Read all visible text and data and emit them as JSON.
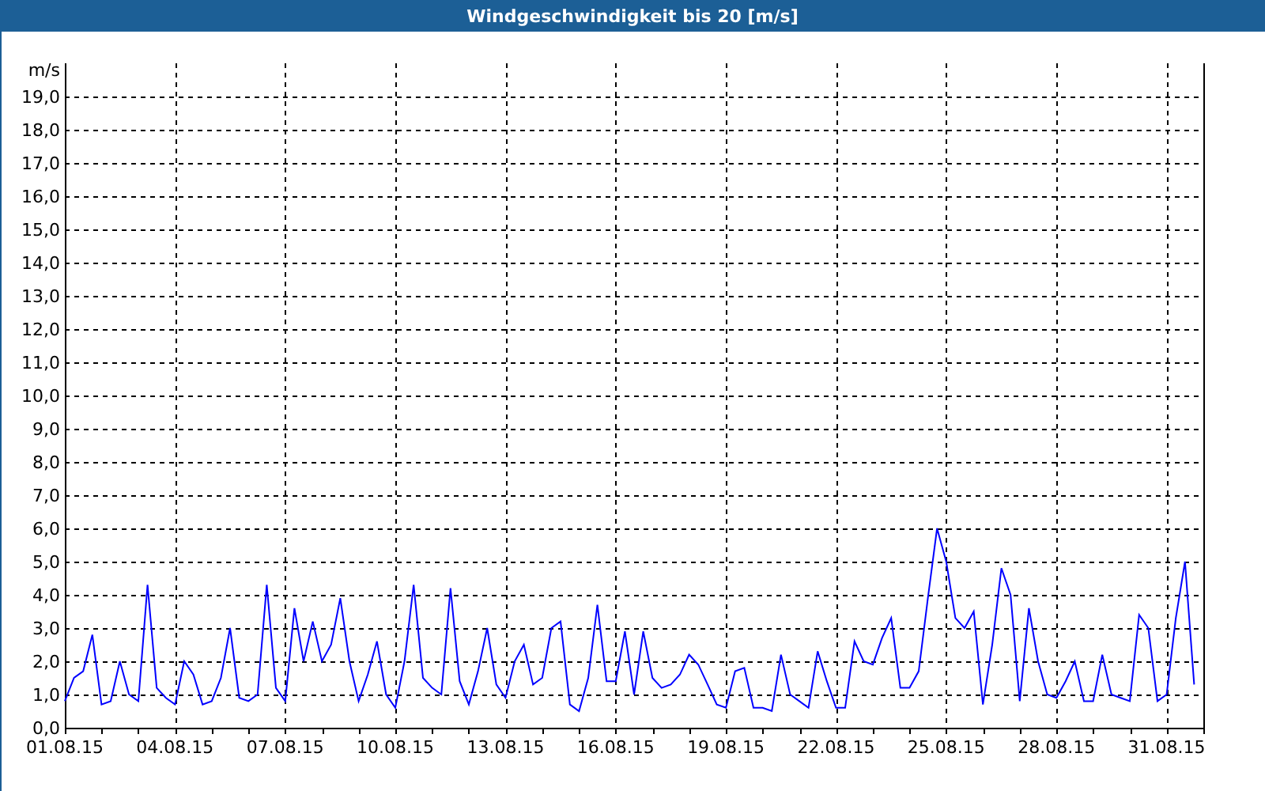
{
  "window": {
    "title": "Windgeschwindigkeit bis 20 [m/s]"
  },
  "chart": {
    "chart_data": {
      "type": "line",
      "grid": true,
      "ylabel": "m/s",
      "ylim": [
        0,
        20
      ],
      "yticks": [
        {
          "value": 0,
          "label": "0,0"
        },
        {
          "value": 1,
          "label": "1,0"
        },
        {
          "value": 2,
          "label": "2,0"
        },
        {
          "value": 3,
          "label": "3,0"
        },
        {
          "value": 4,
          "label": "4,0"
        },
        {
          "value": 5,
          "label": "5,0"
        },
        {
          "value": 6,
          "label": "6,0"
        },
        {
          "value": 7,
          "label": "7,0"
        },
        {
          "value": 8,
          "label": "8,0"
        },
        {
          "value": 9,
          "label": "9,0"
        },
        {
          "value": 10,
          "label": "10,0"
        },
        {
          "value": 11,
          "label": "11,0"
        },
        {
          "value": 12,
          "label": "12,0"
        },
        {
          "value": 13,
          "label": "13,0"
        },
        {
          "value": 14,
          "label": "14,0"
        },
        {
          "value": 15,
          "label": "15,0"
        },
        {
          "value": 16,
          "label": "16,0"
        },
        {
          "value": 17,
          "label": "17,0"
        },
        {
          "value": 18,
          "label": "18,0"
        },
        {
          "value": 19,
          "label": "19,0"
        }
      ],
      "categories": [
        "01.08.15",
        null,
        null,
        null,
        null,
        null,
        null,
        null,
        null,
        null,
        null,
        null,
        "04.08.15",
        null,
        null,
        null,
        null,
        null,
        null,
        null,
        null,
        null,
        null,
        null,
        "07.08.15",
        null,
        null,
        null,
        null,
        null,
        null,
        null,
        null,
        null,
        null,
        null,
        "10.08.15",
        null,
        null,
        null,
        null,
        null,
        null,
        null,
        null,
        null,
        null,
        null,
        "13.08.15",
        null,
        null,
        null,
        null,
        null,
        null,
        null,
        null,
        null,
        null,
        null,
        "16.08.15",
        null,
        null,
        null,
        null,
        null,
        null,
        null,
        null,
        null,
        null,
        null,
        "19.08.15",
        null,
        null,
        null,
        null,
        null,
        null,
        null,
        null,
        null,
        null,
        null,
        "22.08.15",
        null,
        null,
        null,
        null,
        null,
        null,
        null,
        null,
        null,
        null,
        null,
        "25.08.15",
        null,
        null,
        null,
        null,
        null,
        null,
        null,
        null,
        null,
        null,
        null,
        "28.08.15",
        null,
        null,
        null,
        null,
        null,
        null,
        null,
        null,
        null,
        null,
        null,
        "31.08.15",
        null,
        null,
        null
      ],
      "series": [
        {
          "color": "#0000ff",
          "values": [
            0.8,
            1.5,
            1.7,
            2.8,
            0.7,
            0.8,
            2.0,
            1.0,
            0.8,
            4.3,
            1.2,
            0.9,
            0.7,
            2.0,
            1.6,
            0.7,
            0.8,
            1.5,
            3.0,
            0.9,
            0.8,
            1.0,
            4.3,
            1.2,
            0.8,
            3.6,
            2.0,
            3.2,
            2.0,
            2.5,
            3.9,
            2.0,
            0.8,
            1.6,
            2.6,
            1.0,
            0.6,
            2.0,
            4.3,
            1.5,
            1.2,
            1.0,
            4.2,
            1.4,
            0.7,
            1.7,
            3.0,
            1.3,
            0.9,
            2.0,
            2.5,
            1.3,
            1.5,
            3.0,
            3.2,
            0.7,
            0.5,
            1.5,
            3.7,
            1.4,
            1.4,
            2.9,
            1.0,
            2.9,
            1.5,
            1.2,
            1.3,
            1.6,
            2.2,
            1.9,
            1.3,
            0.7,
            0.6,
            1.7,
            1.8,
            0.6,
            0.6,
            0.5,
            2.2,
            1.0,
            0.8,
            0.6,
            2.3,
            1.4,
            0.6,
            0.6,
            2.6,
            2.0,
            1.9,
            2.7,
            3.3,
            1.2,
            1.2,
            1.7,
            3.9,
            6.0,
            5.0,
            3.3,
            3.0,
            3.5,
            0.7,
            2.5,
            4.8,
            4.0,
            0.8,
            3.6,
            2.0,
            1.0,
            0.9,
            1.4,
            2.0,
            0.8,
            0.8,
            2.2,
            1.0,
            0.9,
            0.8,
            3.4,
            3.0,
            0.8,
            1.0,
            3.3,
            5.0,
            1.3
          ]
        }
      ]
    }
  }
}
